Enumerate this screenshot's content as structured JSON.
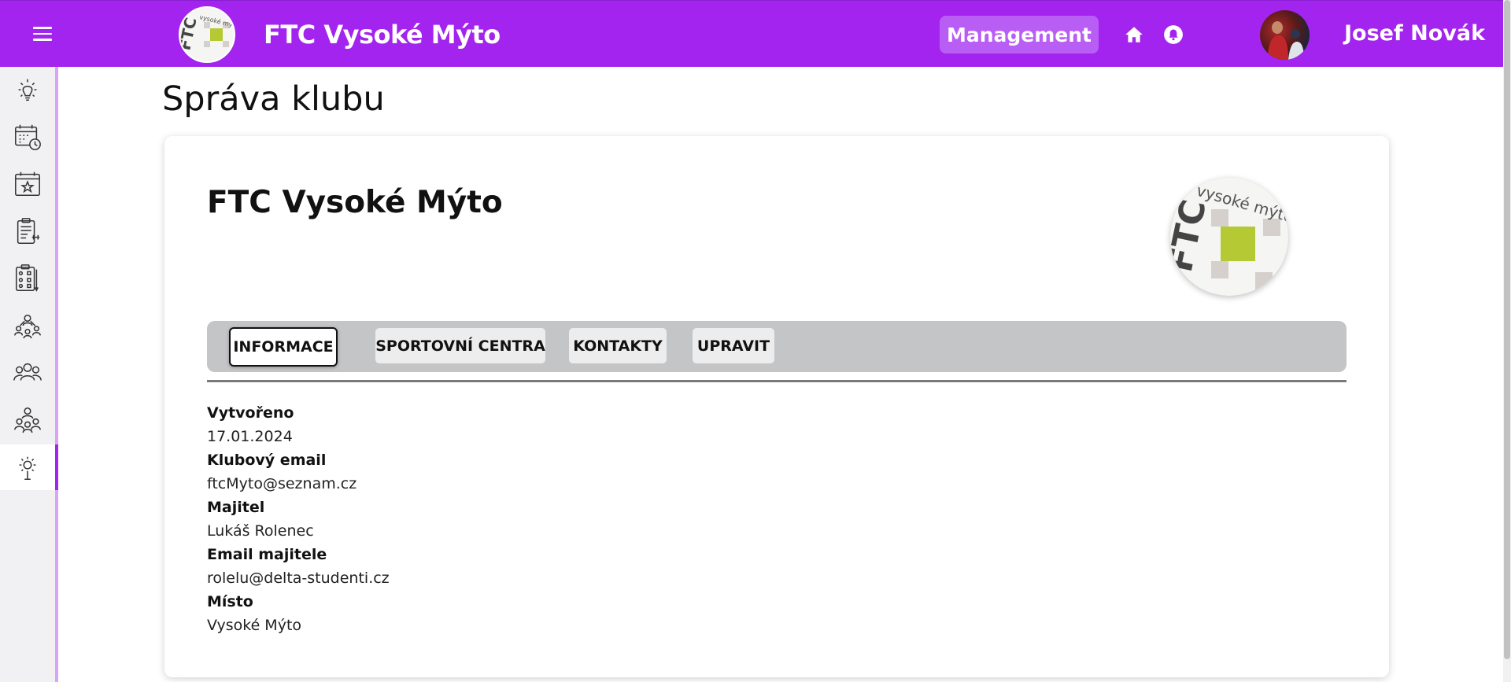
{
  "header": {
    "club_name": "FTC Vysoké Mýto",
    "management_label": "Management",
    "user_name": "Josef Novák",
    "logo_text": "vysoké mýto",
    "logo_letters": "FTC"
  },
  "sidebar": {
    "items": [
      {
        "icon": "lightbulb-icon"
      },
      {
        "icon": "calendar-clock-icon"
      },
      {
        "icon": "calendar-star-icon"
      },
      {
        "icon": "clipboard-training-icon"
      },
      {
        "icon": "tactics-board-icon"
      },
      {
        "icon": "team-network-icon"
      },
      {
        "icon": "group-icon"
      },
      {
        "icon": "organization-icon"
      },
      {
        "icon": "settings-gear-icon",
        "active": true
      }
    ]
  },
  "page": {
    "title": "Správa klubu"
  },
  "card": {
    "title": "FTC Vysoké Mýto",
    "tabs": [
      {
        "label": "INFORMACE",
        "active": true
      },
      {
        "label": "SPORTOVNÍ CENTRA"
      },
      {
        "label": "KONTAKTY"
      },
      {
        "label": "UPRAVIT"
      }
    ],
    "fields": [
      {
        "label": "Vytvořeno",
        "value": "17.01.2024"
      },
      {
        "label": "Klubový email",
        "value": "ftcMyto@seznam.cz"
      },
      {
        "label": "Majitel",
        "value": "Lukáš Rolenec"
      },
      {
        "label": "Email majitele",
        "value": "rolelu@delta-studenti.cz"
      },
      {
        "label": "Místo",
        "value": "Vysoké Mýto"
      }
    ]
  },
  "colors": {
    "accent": "#a324ee",
    "management_button": "#b95ef4",
    "tabs_background": "#c4c5c7",
    "logo_green": "#b5c934",
    "logo_grey": "#d6d0cc"
  }
}
